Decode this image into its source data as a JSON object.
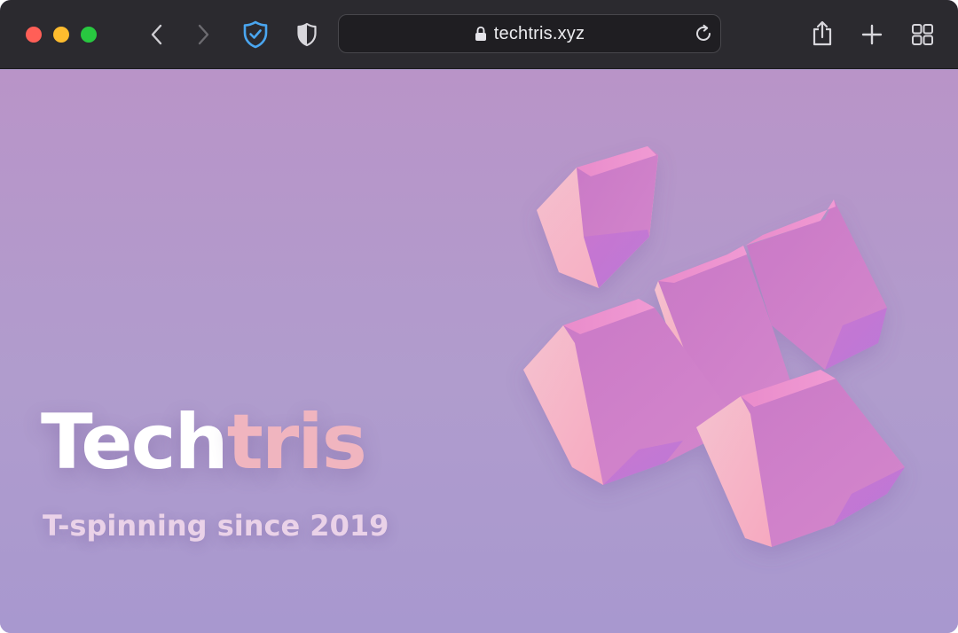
{
  "browser": {
    "url": "techtris.xyz",
    "icons": {
      "back": "chevron-left-icon",
      "forward": "chevron-right-icon",
      "privacy": "shield-check-icon",
      "shield": "half-shield-icon",
      "lock": "lock-icon",
      "reload": "reload-icon",
      "share": "share-icon",
      "new_tab": "plus-icon",
      "tabs": "tab-grid-icon"
    }
  },
  "hero": {
    "brand_part1": "Tech",
    "brand_part2": "tris",
    "tagline": "T-spinning since 2019",
    "colors": {
      "background": "#b29ccd",
      "brand_white": "#ffffff",
      "brand_pink": "#f0b5bf",
      "tagline": "#ead2e8",
      "block_face": "#d27bc8",
      "block_side": "#f3b6c6"
    }
  }
}
